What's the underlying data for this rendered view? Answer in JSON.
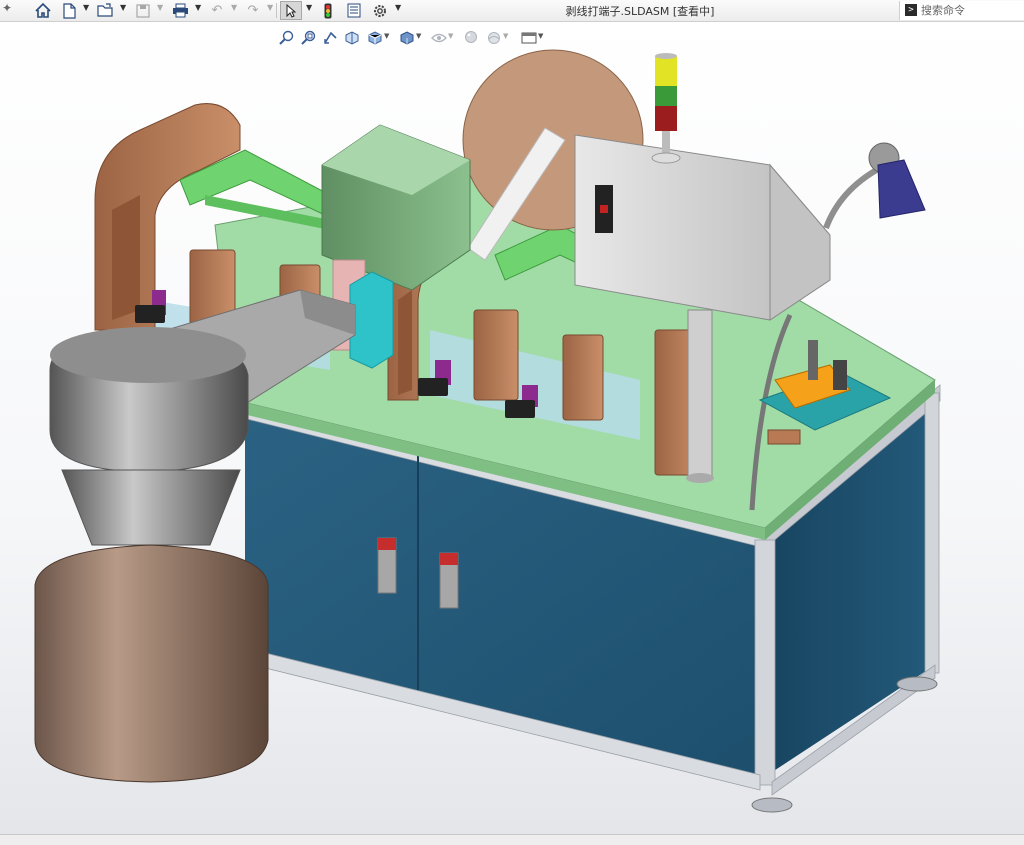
{
  "window": {
    "title": "剥线打端子.SLDASM [查看中]"
  },
  "toolbar": {
    "items": [
      {
        "name": "pin-icon",
        "glyph": "✦"
      },
      {
        "name": "home-icon",
        "glyph": "⌂"
      },
      {
        "name": "new-document-icon",
        "glyph": "🗋"
      },
      {
        "name": "open-folder-icon",
        "glyph": "📂"
      },
      {
        "name": "save-icon",
        "glyph": "💾"
      },
      {
        "name": "print-icon",
        "glyph": "🖶"
      },
      {
        "name": "undo-icon",
        "glyph": "↶"
      },
      {
        "name": "redo-icon",
        "glyph": "↷"
      },
      {
        "name": "select-pointer-icon",
        "glyph": "↖"
      },
      {
        "name": "traffic-light-icon",
        "glyph": "●"
      },
      {
        "name": "file-properties-icon",
        "glyph": "▤"
      },
      {
        "name": "options-gear-icon",
        "glyph": "⚙"
      }
    ]
  },
  "search": {
    "placeholder": "搜索命令",
    "icon_glyph": ">"
  },
  "heads_up_toolbar": {
    "items": [
      {
        "name": "zoom-to-fit-icon",
        "glyph": "⌕"
      },
      {
        "name": "zoom-to-area-icon",
        "glyph": "⌕"
      },
      {
        "name": "previous-view-icon",
        "glyph": "↺"
      },
      {
        "name": "section-view-icon",
        "glyph": "◧"
      },
      {
        "name": "view-orientation-icon",
        "glyph": "◩"
      },
      {
        "name": "display-style-icon",
        "glyph": "◨"
      },
      {
        "name": "hide-show-items-icon",
        "glyph": "◈"
      },
      {
        "name": "edit-appearance-icon",
        "glyph": "◍"
      },
      {
        "name": "apply-scene-icon",
        "glyph": "◐"
      },
      {
        "name": "view-settings-icon",
        "glyph": "▭"
      }
    ]
  },
  "colors": {
    "toolbar_icon": "#2a4a7a",
    "tabletop": "#9ed9a3",
    "cabinet": "#245a78",
    "frame": "#cfd3d9",
    "wood": "#b77a55",
    "green_rail": "#6bd36b",
    "lamp": "#3b3b8f"
  }
}
